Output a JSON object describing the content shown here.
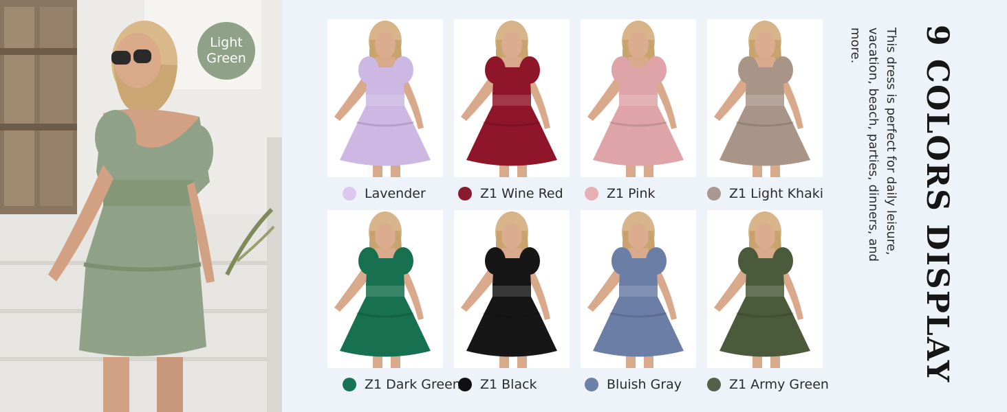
{
  "hero": {
    "badge_text": "Light\nGreen",
    "dress_color": "#8fa287"
  },
  "title": "9 COLORS DISPLAY",
  "description": "This dress is perfect for daily leisure, vacation, beach, parties, dinners, and more.",
  "swatches": [
    {
      "name": "Lavender",
      "color": "#cdb8e4",
      "dot": "#dcc8ee"
    },
    {
      "name": "Z1 Wine Red",
      "color": "#8e1628",
      "dot": "#8a1a2e"
    },
    {
      "name": "Z1 Pink",
      "color": "#dea4a8",
      "dot": "#e6afb4"
    },
    {
      "name": "Z1 Light Khaki",
      "color": "#a89588",
      "dot": "#a89890"
    },
    {
      "name": "Z1 Dark Green",
      "color": "#17704f",
      "dot": "#177356"
    },
    {
      "name": "Z1 Black",
      "color": "#161616",
      "dot": "#101010"
    },
    {
      "name": "Bluish Gray",
      "color": "#6a7ea6",
      "dot": "#6c7fa6"
    },
    {
      "name": "Z1 Army Green",
      "color": "#4b5a3a",
      "dot": "#55604a"
    }
  ]
}
